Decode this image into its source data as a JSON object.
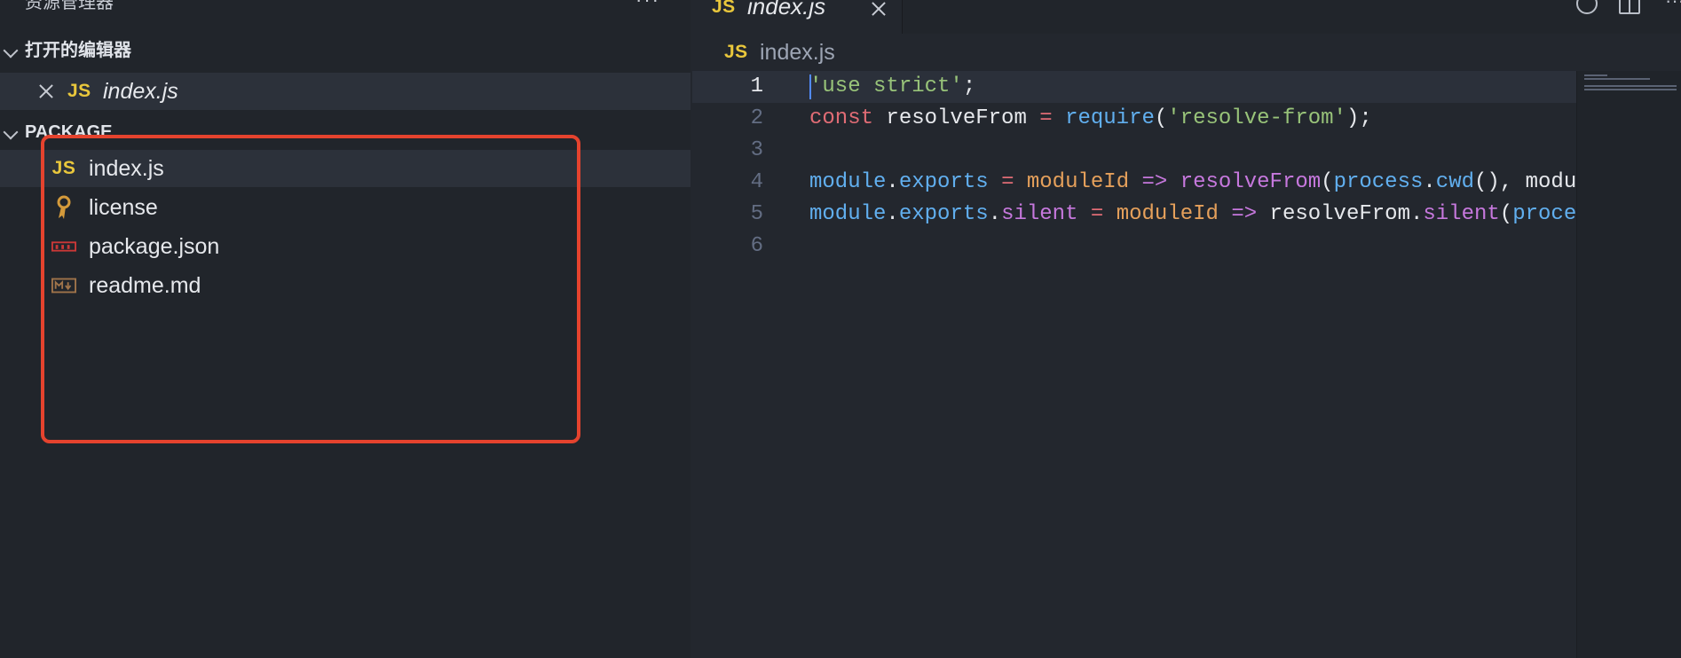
{
  "explorer": {
    "title": "资源管理器",
    "more": "···",
    "open_editors": {
      "title": "打开的编辑器",
      "items": [
        {
          "badge": "JS",
          "name": "index.js"
        }
      ]
    },
    "package": {
      "title": "PACKAGE",
      "files": [
        {
          "icon": "js-file-icon",
          "badge": "JS",
          "name": "index.js"
        },
        {
          "icon": "license-key-icon",
          "name": "license"
        },
        {
          "icon": "npm-icon",
          "name": "package.json"
        },
        {
          "icon": "markdown-icon",
          "name": "readme.md"
        }
      ]
    }
  },
  "editor": {
    "tab": {
      "badge": "JS",
      "name": "index.js"
    },
    "breadcrumb": {
      "badge": "JS",
      "name": "index.js"
    },
    "lines": [
      {
        "n": "1",
        "tokens": [
          [
            "str",
            "'use strict'"
          ],
          [
            "id",
            ";"
          ]
        ]
      },
      {
        "n": "2",
        "tokens": [
          [
            "kw",
            "const"
          ],
          [
            "id",
            " resolveFrom "
          ],
          [
            "kw",
            "="
          ],
          [
            "id",
            " "
          ],
          [
            "fn",
            "require"
          ],
          [
            "id",
            "("
          ],
          [
            "str",
            "'resolve-from'"
          ],
          [
            "id",
            ");"
          ]
        ]
      },
      {
        "n": "3",
        "tokens": []
      },
      {
        "n": "4",
        "tokens": [
          [
            "prop",
            "module"
          ],
          [
            "id",
            "."
          ],
          [
            "prop",
            "exports"
          ],
          [
            "id",
            " "
          ],
          [
            "kw",
            "="
          ],
          [
            "id",
            " "
          ],
          [
            "param",
            "moduleId"
          ],
          [
            "id",
            " "
          ],
          [
            "mem",
            "=>"
          ],
          [
            "id",
            " "
          ],
          [
            "mem",
            "resolveFrom"
          ],
          [
            "id",
            "("
          ],
          [
            "fn",
            "process"
          ],
          [
            "id",
            "."
          ],
          [
            "fn",
            "cwd"
          ],
          [
            "id",
            "(), modu"
          ]
        ]
      },
      {
        "n": "5",
        "tokens": [
          [
            "prop",
            "module"
          ],
          [
            "id",
            "."
          ],
          [
            "prop",
            "exports"
          ],
          [
            "id",
            "."
          ],
          [
            "mem",
            "silent"
          ],
          [
            "id",
            " "
          ],
          [
            "kw",
            "="
          ],
          [
            "id",
            " "
          ],
          [
            "param",
            "moduleId"
          ],
          [
            "id",
            " "
          ],
          [
            "mem",
            "=>"
          ],
          [
            "id",
            " resolveFrom."
          ],
          [
            "mem",
            "silent"
          ],
          [
            "id",
            "("
          ],
          [
            "fn",
            "proce"
          ]
        ]
      },
      {
        "n": "6",
        "tokens": []
      }
    ]
  },
  "colors": {
    "highlight_border": "#e5432e",
    "js_badge": "#e9c73c"
  }
}
